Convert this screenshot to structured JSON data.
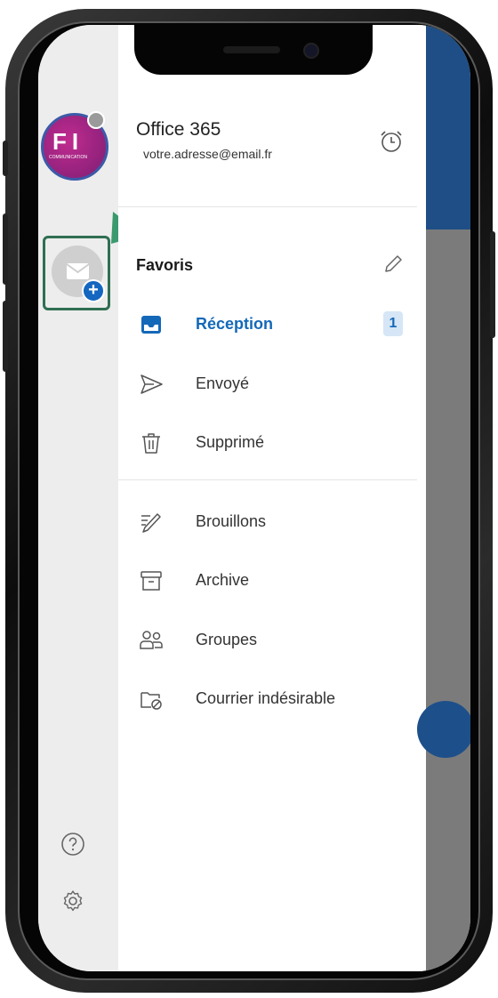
{
  "account": {
    "name": "Office 365",
    "email": "votre.adresse@email.fr",
    "avatar_text": "FI",
    "avatar_subtext": "COMMUNICATION"
  },
  "favorites": {
    "title": "Favoris"
  },
  "folders": [
    {
      "label": "Réception",
      "icon": "inbox-icon",
      "badge": "1",
      "active": true
    },
    {
      "label": "Envoyé",
      "icon": "send-icon"
    },
    {
      "label": "Supprimé",
      "icon": "trash-icon"
    },
    {
      "label": "Brouillons",
      "icon": "draft-icon"
    },
    {
      "label": "Archive",
      "icon": "archive-icon"
    },
    {
      "label": "Groupes",
      "icon": "groups-icon"
    },
    {
      "label": "Courrier indésirable",
      "icon": "junk-icon"
    }
  ],
  "colors": {
    "accent": "#1468b8",
    "highlight_box": "#2f6e52",
    "arrow": "#3a9a6e"
  }
}
